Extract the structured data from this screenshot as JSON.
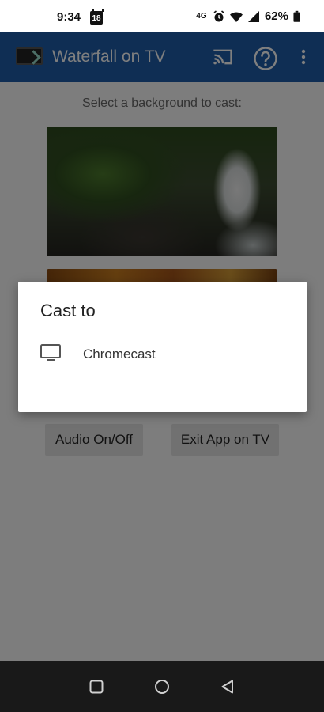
{
  "status_bar": {
    "time": "9:34",
    "calendar_day": "18",
    "network_label": "4G",
    "battery_percent": "62%"
  },
  "app_bar": {
    "title": "Waterfall on TV",
    "icons": [
      "cast-icon",
      "help-icon",
      "more-vert-icon"
    ],
    "background_color": "#1f5ca8"
  },
  "main": {
    "select_label": "Select a background to cast:",
    "buttons": {
      "audio": "Audio On/Off",
      "exit": "Exit App on TV"
    }
  },
  "dialog": {
    "title": "Cast to",
    "routes": [
      {
        "icon": "tv-icon",
        "label": "Chromecast"
      }
    ]
  },
  "nav_bar": {
    "icons": [
      "recents-icon",
      "home-icon",
      "back-icon"
    ]
  }
}
